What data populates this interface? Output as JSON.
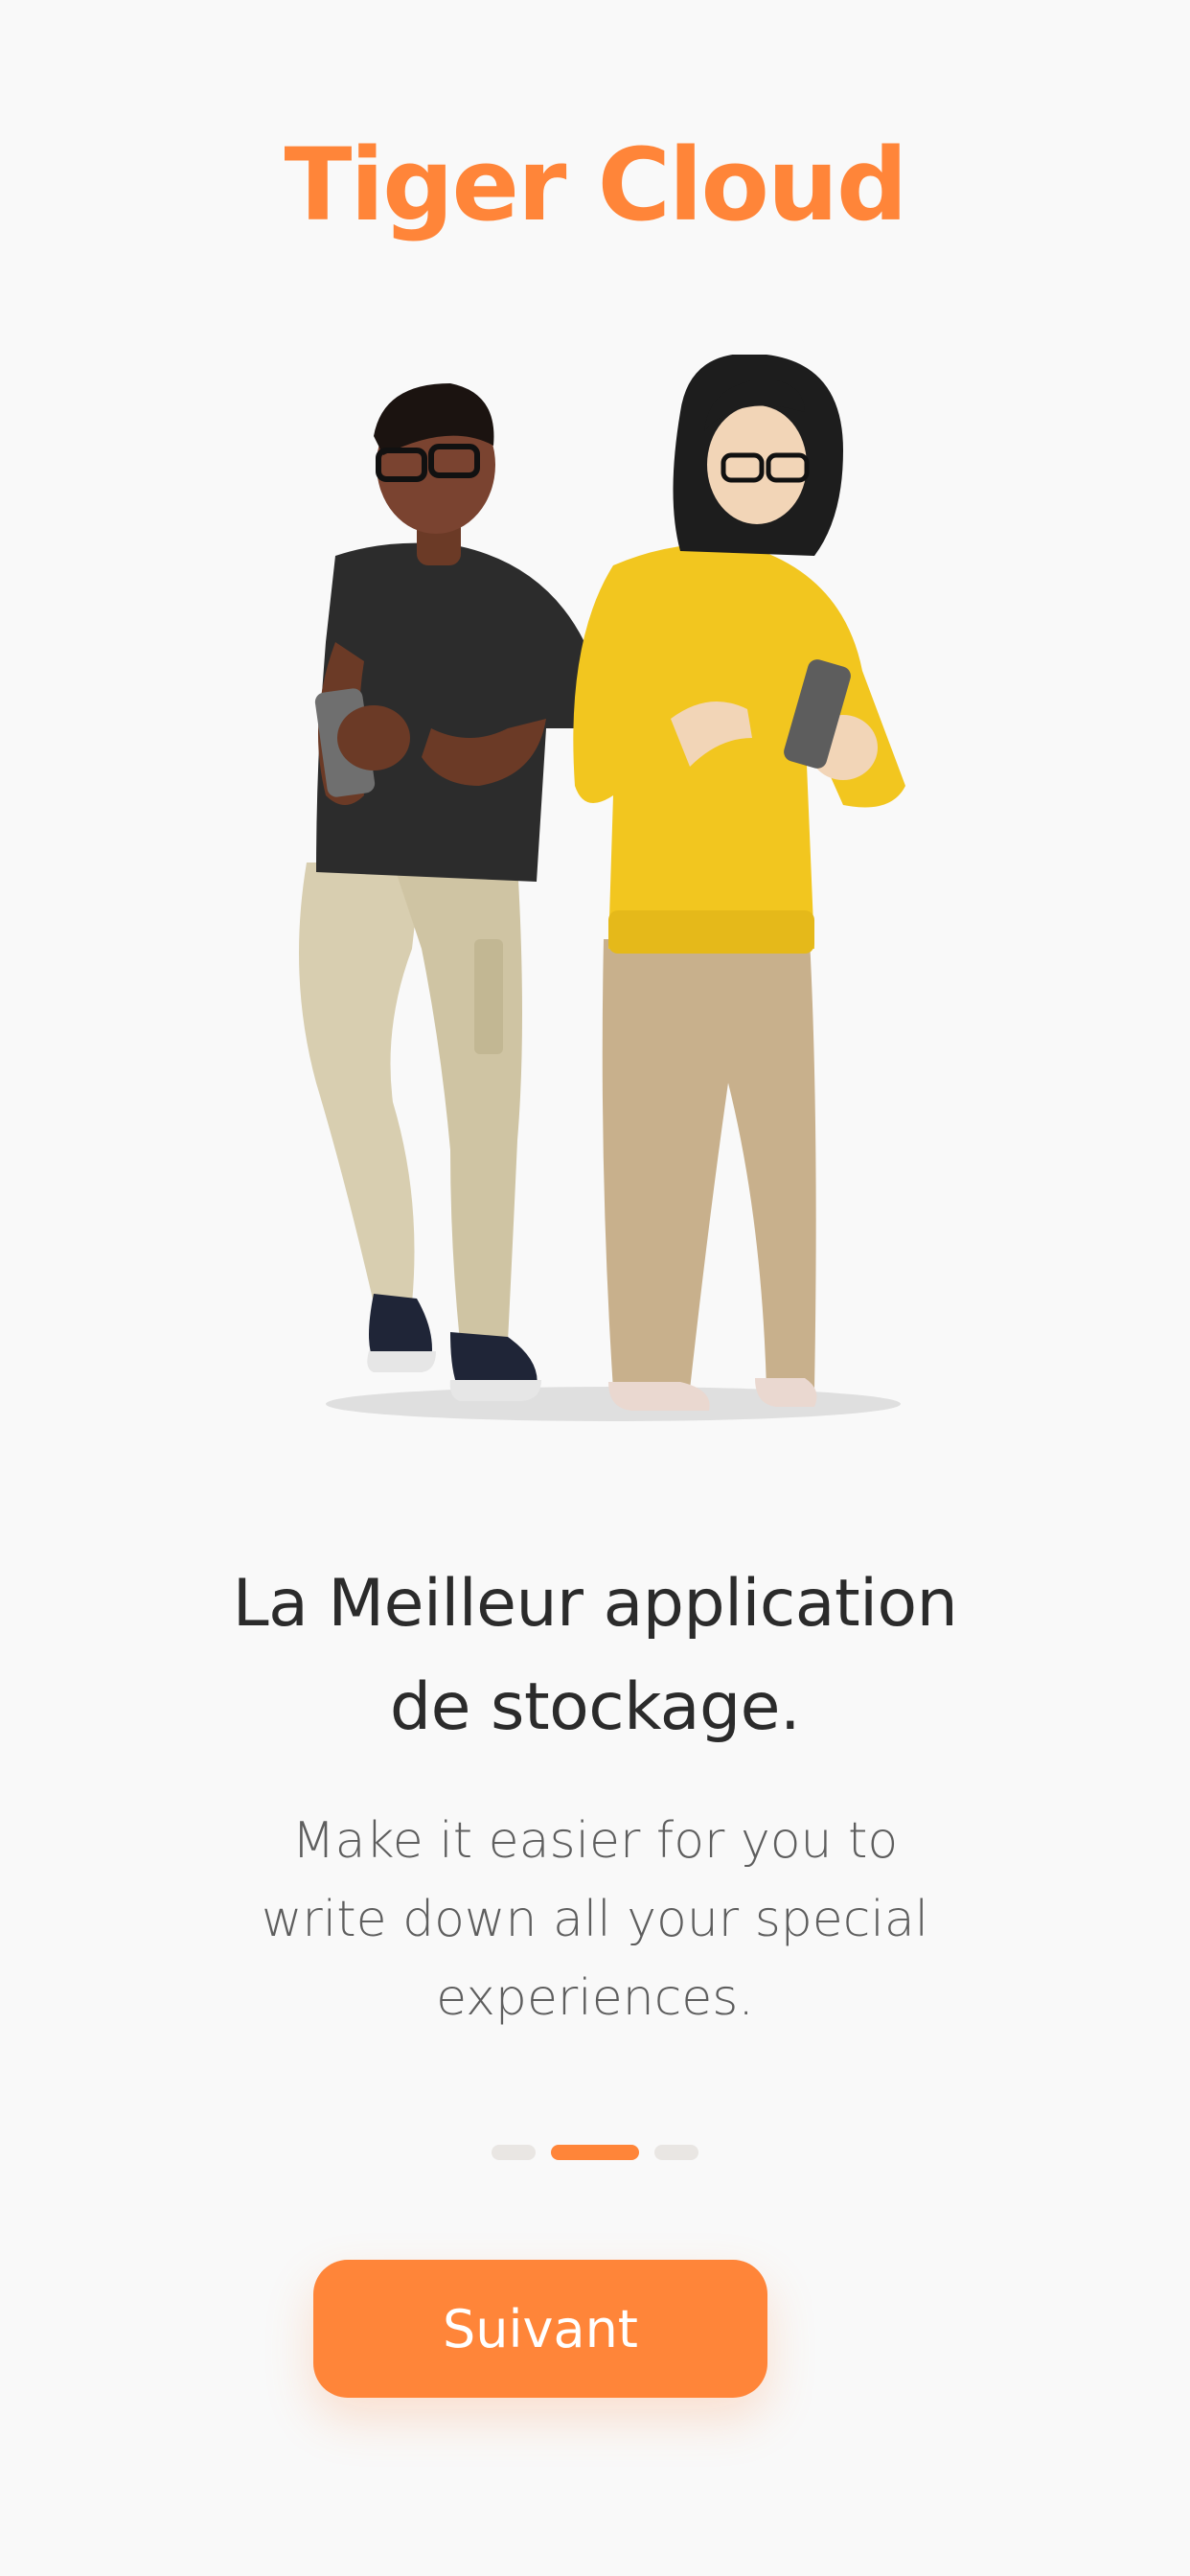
{
  "app": {
    "title": "Tiger Cloud"
  },
  "onboarding": {
    "heading_line1": "La Meilleur application",
    "heading_line2": "de stockage.",
    "subtitle_line1": "Make it easier for you to",
    "subtitle_line2": "write down all your special",
    "subtitle_line3": "experiences.",
    "pager": {
      "total": 3,
      "active_index": 1
    },
    "next_button_label": "Suivant"
  },
  "colors": {
    "accent": "#ff8539",
    "background": "#f9f9f9",
    "heading": "#2b2b2b",
    "body_text": "#5e5e5e",
    "inactive_dot": "#e9e6e3"
  },
  "illustration": {
    "icon": "two-people-with-phones-illustration"
  }
}
